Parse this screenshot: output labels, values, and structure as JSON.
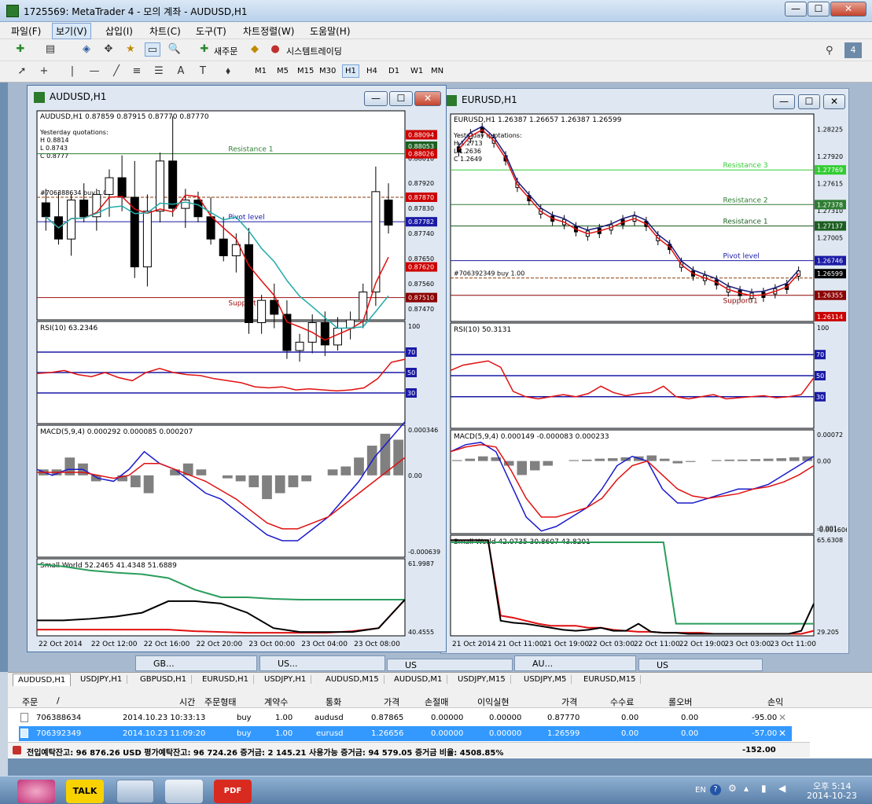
{
  "window": {
    "title": "1725569: MetaTrader 4 - 모의 계좌 - AUDUSD,H1",
    "minimize": "—",
    "maximize": "☐",
    "close": "✕"
  },
  "menu": [
    "파일(F)",
    "보기(V)",
    "삽입(I)",
    "차트(C)",
    "도구(T)",
    "차트정렬(W)",
    "도움말(H)"
  ],
  "toolbar": {
    "new_order": "새주문",
    "auto_trading": "시스템트레이딩",
    "timeframes": [
      "M1",
      "M5",
      "M15",
      "M30",
      "H1",
      "H4",
      "D1",
      "W1",
      "MN"
    ]
  },
  "chart_data": [
    {
      "type": "candlestick",
      "symbol": "AUDUSD,H1",
      "header": "AUDUSD,H1  0.87859 0.87915 0.87770 0.87770",
      "yesterday": [
        "Yesterday quotations:",
        "H 0.8814",
        "L 0.8743",
        "C 0.8777"
      ],
      "order_label": "#706388634 buy 1.00",
      "levels": [
        {
          "label": "Resistance 1",
          "value": 0.88026,
          "color": "#2e7d32"
        },
        {
          "label": "Pivot level",
          "value": 0.87782,
          "color": "#1a1aa6"
        },
        {
          "label": "Support 1",
          "value": 0.8751,
          "color": "#a01010"
        }
      ],
      "price_tags": [
        {
          "value": "0.88094",
          "color": "#cc0000"
        },
        {
          "value": "0.88053",
          "color": "#1b5e20"
        },
        {
          "value": "0.88026",
          "color": "#cc0000"
        },
        {
          "value": "0.87870",
          "color": "#cc0000"
        },
        {
          "value": "0.87782",
          "color": "#1a1aa6"
        },
        {
          "value": "0.87620",
          "color": "#cc0000"
        },
        {
          "value": "0.87510",
          "color": "#8b0000"
        }
      ],
      "y_ticks": [
        "0.88010",
        "0.87920",
        "0.87830",
        "0.87740",
        "0.87650",
        "0.87560",
        "0.87470"
      ],
      "ylim": [
        0.8743,
        0.8818
      ],
      "x_ticks": [
        "22 Oct 2014",
        "22 Oct 12:00",
        "22 Oct 16:00",
        "22 Oct 20:00",
        "23 Oct 00:00",
        "23 Oct 04:00",
        "23 Oct 08:00"
      ],
      "candles": [
        [
          0.8785,
          0.879,
          0.8775,
          0.878
        ],
        [
          0.878,
          0.8789,
          0.877,
          0.8772
        ],
        [
          0.8772,
          0.8788,
          0.8766,
          0.8786
        ],
        [
          0.8786,
          0.8792,
          0.8778,
          0.878
        ],
        [
          0.878,
          0.879,
          0.8775,
          0.8788
        ],
        [
          0.8788,
          0.8797,
          0.878,
          0.8794
        ],
        [
          0.8794,
          0.8802,
          0.8782,
          0.8787
        ],
        [
          0.8787,
          0.88,
          0.8758,
          0.8762
        ],
        [
          0.8762,
          0.8788,
          0.8755,
          0.8782
        ],
        [
          0.8782,
          0.8803,
          0.8778,
          0.88
        ],
        [
          0.88,
          0.8816,
          0.878,
          0.8783
        ],
        [
          0.8783,
          0.879,
          0.8776,
          0.8786
        ],
        [
          0.8786,
          0.8789,
          0.8778,
          0.878
        ],
        [
          0.878,
          0.8787,
          0.877,
          0.8772
        ],
        [
          0.8772,
          0.878,
          0.8764,
          0.8766
        ],
        [
          0.8766,
          0.8774,
          0.876,
          0.877
        ],
        [
          0.877,
          0.8776,
          0.8738,
          0.8742
        ],
        [
          0.8742,
          0.8752,
          0.8738,
          0.875
        ],
        [
          0.875,
          0.8756,
          0.874,
          0.8745
        ],
        [
          0.8745,
          0.875,
          0.8729,
          0.8732
        ],
        [
          0.8732,
          0.8738,
          0.8728,
          0.8735
        ],
        [
          0.8735,
          0.8745,
          0.8731,
          0.8742
        ],
        [
          0.8742,
          0.8746,
          0.873,
          0.8734
        ],
        [
          0.8734,
          0.8744,
          0.8732,
          0.874
        ],
        [
          0.874,
          0.8746,
          0.8736,
          0.8743
        ],
        [
          0.8743,
          0.8756,
          0.874,
          0.8753
        ],
        [
          0.8753,
          0.8798,
          0.8748,
          0.8789
        ],
        [
          0.8786,
          0.8792,
          0.8774,
          0.8777
        ]
      ]
    },
    {
      "type": "candlestick",
      "symbol": "EURUSD,H1",
      "header": "EURUSD,H1  1.26387 1.26657 1.26387 1.26599",
      "yesterday": [
        "Yesterday quotations:",
        "H 1.2713",
        "L 1.2636",
        "C 1.2649"
      ],
      "order_label": "#706392349 buy 1.00",
      "levels": [
        {
          "label": "Resistance 3",
          "value": 1.27769,
          "color": "#33cc33"
        },
        {
          "label": "Resistance 2",
          "value": 1.27378,
          "color": "#2e7d32"
        },
        {
          "label": "Resistance 1",
          "value": 1.27137,
          "color": "#1b5e20"
        },
        {
          "label": "Pivot level",
          "value": 1.26746,
          "color": "#1a1aa6"
        },
        {
          "label": "Support 1",
          "value": 1.26355,
          "color": "#8b0000"
        }
      ],
      "price_tags": [
        {
          "value": "1.27769",
          "color": "#33cc33"
        },
        {
          "value": "1.27378",
          "color": "#2e7d32"
        },
        {
          "value": "1.27137",
          "color": "#1b5e20"
        },
        {
          "value": "1.26746",
          "color": "#1a1aa6"
        },
        {
          "value": "1.26599",
          "color": "#000000"
        },
        {
          "value": "1.26355",
          "color": "#8b0000"
        },
        {
          "value": "1.26114",
          "color": "#cc0000"
        }
      ],
      "y_ticks": [
        "1.28225",
        "1.27920",
        "1.27615",
        "1.27310",
        "1.27005"
      ],
      "ylim": [
        1.2606,
        1.284
      ],
      "x_ticks": [
        "21 Oct 2014",
        "21 Oct 11:00",
        "21 Oct 19:00",
        "22 Oct 03:00",
        "22 Oct 11:00",
        "22 Oct 19:00",
        "23 Oct 03:00",
        "23 Oct 11:00"
      ]
    }
  ],
  "rsi": {
    "aud_label": "RSI(10) 63.2346",
    "eur_label": "RSI(10) 50.3131",
    "levels": [
      "70",
      "50",
      "30"
    ],
    "scale_top": "100",
    "scale_bottom": "0"
  },
  "macd": {
    "aud_label": "MACD(5,9,4) 0.000292 0.000085 0.000207",
    "eur_label": "MACD(5,9,4) 0.000149 -0.000083 0.000233",
    "aud_scale": [
      "0.000346",
      "0.00",
      "-0.000639"
    ],
    "eur_scale": [
      "0.00072",
      "0.00",
      "-0.001",
      "-0.001606"
    ]
  },
  "smallworld": {
    "aud_label": "Small World 52.2465 41.4348 51.6889",
    "eur_label": "Small World 42.0735 30.8607 43.8201",
    "aud_scale": [
      "61.9987",
      "40.4555"
    ],
    "eur_scale": [
      "65.6308",
      "29.205"
    ]
  },
  "minimized": [
    "GB...",
    "US...",
    "US",
    "AU...",
    "US"
  ],
  "chart_tabs": [
    "AUDUSD,H1",
    "USDJPY,H1",
    "GBPUSD,H1",
    "EURUSD,H1",
    "USDJPY,H1",
    "AUDUSD,M15",
    "AUDUSD,M1",
    "USDJPY,M15",
    "USDJPY,M5",
    "EURUSD,M15"
  ],
  "terminal": {
    "headers": [
      "주문",
      "/",
      "시간",
      "주문형태",
      "계약수",
      "통화",
      "가격",
      "손절매",
      "이익실현",
      "가격",
      "수수료",
      "롤오버",
      "손익"
    ],
    "rows": [
      [
        "706388634",
        "2014.10.23 10:33:13",
        "buy",
        "1.00",
        "audusd",
        "0.87865",
        "0.00000",
        "0.00000",
        "0.87770",
        "0.00",
        "0.00",
        "-95.00"
      ],
      [
        "706392349",
        "2014.10.23 11:09:20",
        "buy",
        "1.00",
        "eurusd",
        "1.26656",
        "0.00000",
        "0.00000",
        "1.26599",
        "0.00",
        "0.00",
        "-57.00"
      ]
    ],
    "summary": "전입예탁잔고: 96 876.26 USD  평가예탁잔고: 96 724.26  증거금: 2 145.21  사용가능 증거금: 94 579.05  증거금 비율: 4508.85%",
    "total": "-152.00"
  },
  "taskbar": {
    "lang": "EN",
    "clock_time": "오후 5:14",
    "clock_date": "2014-10-23"
  }
}
